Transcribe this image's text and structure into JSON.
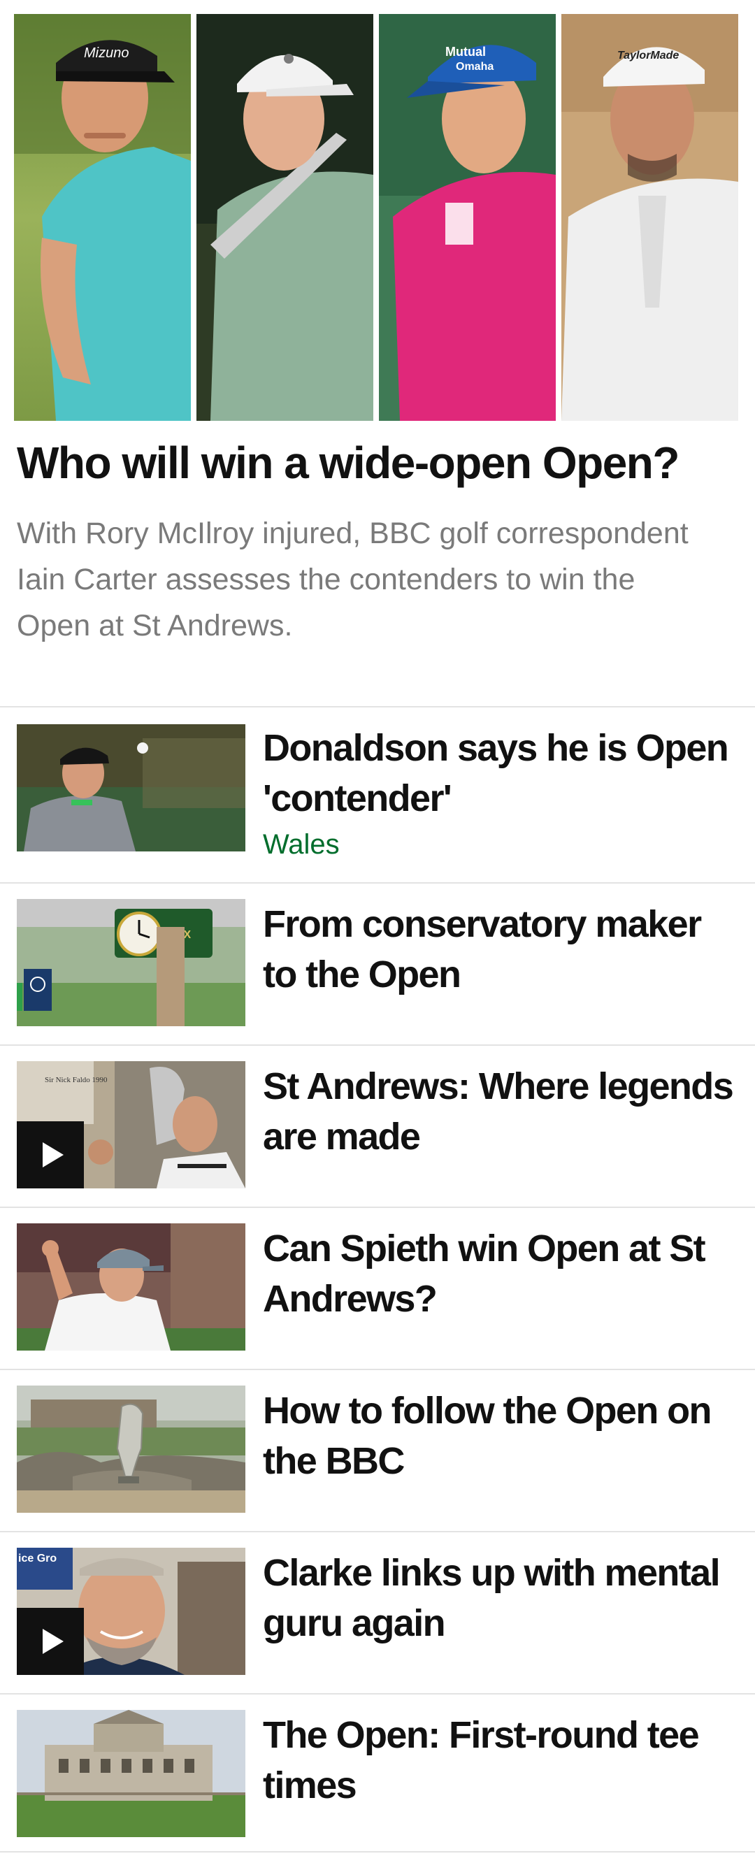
{
  "hero": {
    "image_alt": "Four golfers: Luke Donald, Jordan Spieth, Henrik Stenson, Dustin Johnson",
    "headline": "Who will win a wide-open Open?",
    "summary": "With Rory McIlroy injured, BBC golf correspondent Iain Carter assesses the contenders to win the Open at St Andrews.",
    "cap_logos": [
      "Mizuno",
      "Mutual of Omaha",
      "TaylorMade"
    ]
  },
  "stories": [
    {
      "title": "Donaldson says he is Open 'contender'",
      "tag": "Wales",
      "video": false,
      "icon": "photo-golfer-cap"
    },
    {
      "title": "From conservatory maker to the Open",
      "tag": "",
      "video": false,
      "icon": "photo-clock-golfer",
      "thumb_text": "LEX"
    },
    {
      "title": "St Andrews: Where legends are made",
      "tag": "",
      "video": true,
      "icon": "photo-trophy-kiss",
      "thumb_text": "Sir Nick Faldo 1990"
    },
    {
      "title": "Can Spieth win Open at St Andrews?",
      "tag": "",
      "video": false,
      "icon": "photo-fist-pump"
    },
    {
      "title": "How to follow the Open on the BBC",
      "tag": "",
      "video": false,
      "icon": "photo-claret-jug"
    },
    {
      "title": "Clarke links up with mental guru again",
      "tag": "",
      "video": true,
      "icon": "photo-smiling-golfer"
    },
    {
      "title": "The Open: First-round tee times",
      "tag": "",
      "video": false,
      "icon": "photo-clubhouse"
    }
  ],
  "colors": {
    "tag_green": "#006d2c",
    "divider": "#e3e3e3",
    "summary_grey": "#7a7a7a"
  }
}
